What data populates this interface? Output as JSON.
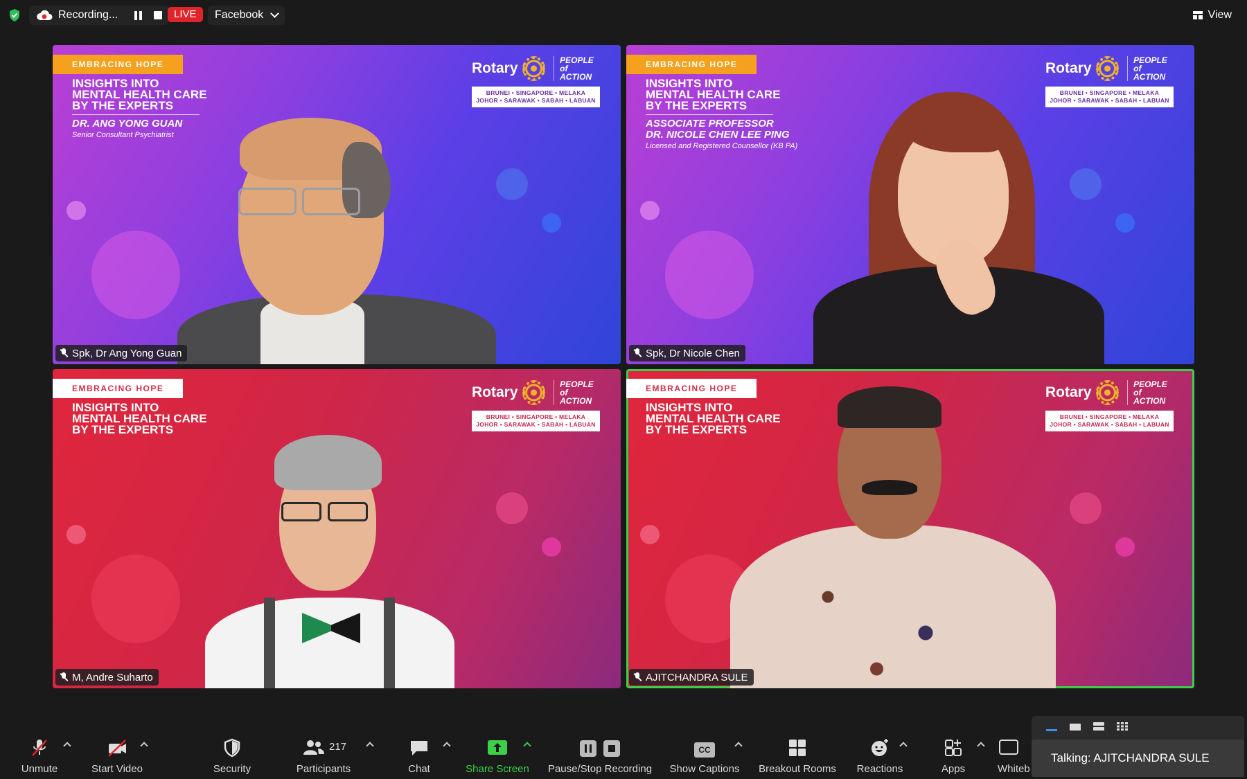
{
  "topbar": {
    "recording_label": "Recording...",
    "live_label": "LIVE",
    "stream_target": "Facebook",
    "view_label": "View"
  },
  "tiles": [
    {
      "tag": "EMBRACING HOPE",
      "title_lines": [
        "INSIGHTS INTO",
        "MENTAL HEALTH CARE",
        "BY THE EXPERTS"
      ],
      "speaker_lines": [
        "DR. ANG YONG GUAN"
      ],
      "role": "Senior Consultant Psychiatrist",
      "name": "Spk, Dr Ang Yong Guan",
      "theme": "purple"
    },
    {
      "tag": "EMBRACING HOPE",
      "title_lines": [
        "INSIGHTS INTO",
        "MENTAL HEALTH CARE",
        "BY THE EXPERTS"
      ],
      "speaker_lines": [
        "ASSOCIATE PROFESSOR",
        "DR. NICOLE CHEN LEE PING"
      ],
      "role": "Licensed and Registered Counsellor (KB PA)",
      "name": "Spk, Dr Nicole Chen",
      "theme": "purple"
    },
    {
      "tag": "EMBRACING HOPE",
      "title_lines": [
        "INSIGHTS INTO",
        "MENTAL HEALTH CARE",
        "BY THE EXPERTS"
      ],
      "name": "M, Andre Suharto",
      "theme": "red"
    },
    {
      "tag": "EMBRACING HOPE",
      "title_lines": [
        "INSIGHTS INTO",
        "MENTAL HEALTH CARE",
        "BY THE EXPERTS"
      ],
      "name": "AJITCHANDRA SULE",
      "theme": "red",
      "active_speaker": true
    }
  ],
  "brand": {
    "rotary": "Rotary",
    "pofa_line1": "PEOPLE of",
    "pofa_line2": "ACTION",
    "clubs_line1": "BRUNEI • SINGAPORE • MELAKA",
    "clubs_line2": "JOHOR • SARAWAK • SABAH • LABUAN"
  },
  "toolbar": {
    "unmute": "Unmute",
    "start_video": "Start Video",
    "security": "Security",
    "participants": "Participants",
    "participant_count": "217",
    "chat": "Chat",
    "share_screen": "Share Screen",
    "pause_stop_recording": "Pause/Stop Recording",
    "show_captions": "Show Captions",
    "captions_badge": "CC",
    "breakout_rooms": "Breakout Rooms",
    "reactions": "Reactions",
    "apps": "Apps",
    "whiteboards": "Whiteb"
  },
  "talking": {
    "label": "Talking: AJITCHANDRA SULE"
  },
  "colors": {
    "share_green": "#3ccf4a",
    "live_red": "#e0242b",
    "active_border": "#3ccf4a"
  }
}
